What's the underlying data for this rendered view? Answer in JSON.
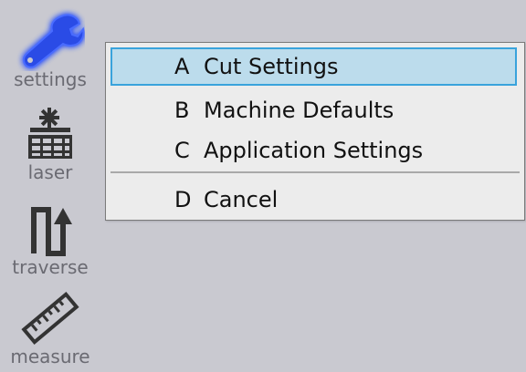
{
  "toolbar": {
    "settings_label": "settings",
    "laser_label": "laser",
    "traverse_label": "traverse",
    "measure_label": "measure",
    "settings_icon": "wrench-icon",
    "laser_icon": "laser-grid-icon",
    "traverse_icon": "traverse-path-icon",
    "measure_icon": "ruler-icon",
    "active_glow_color": "#4a6cff"
  },
  "menu": {
    "items": [
      {
        "key": "A",
        "label": "Cut Settings",
        "highlighted": true
      },
      {
        "key": "B",
        "label": "Machine Defaults",
        "highlighted": false
      },
      {
        "key": "C",
        "label": "Application Settings",
        "highlighted": false
      },
      {
        "key": "D",
        "label": "Cancel",
        "highlighted": false
      }
    ],
    "highlight_color": "#bcdcec",
    "highlight_border_color": "#39a3dc"
  }
}
